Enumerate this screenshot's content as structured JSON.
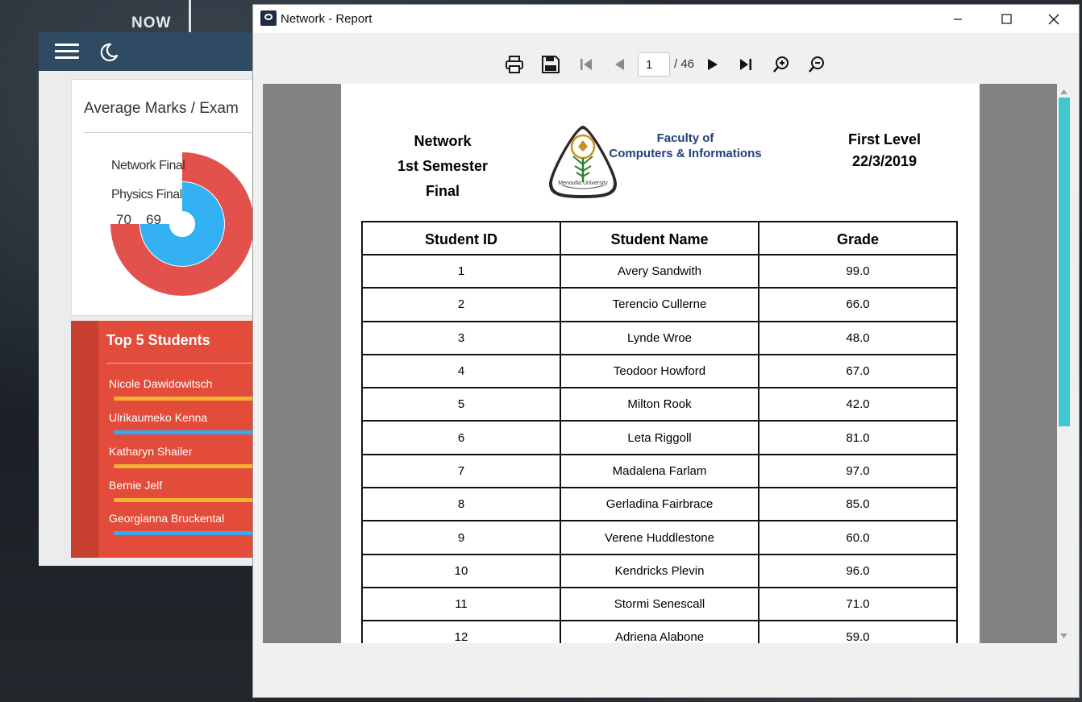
{
  "desktop": {
    "bg_text": "NOW"
  },
  "dashboard": {
    "average_card": {
      "title": "Average Marks / Exam",
      "legend": [
        "Network Final",
        "Physics Final"
      ],
      "values": [
        "70",
        "69"
      ],
      "colors": {
        "network": "#e2514c",
        "physics": "#34b1f3"
      }
    },
    "top5": {
      "title": "Top 5 Students",
      "students": [
        {
          "name": "Nicole Dawidowitsch",
          "bar_color": "#f2b233"
        },
        {
          "name": "Ulrikaumeko Kenna",
          "bar_color": "#35a9f1"
        },
        {
          "name": "Katharyn Shailer",
          "bar_color": "#f2b233"
        },
        {
          "name": "Bernie Jelf",
          "bar_color": "#f2b233"
        },
        {
          "name": "Georgianna Bruckental",
          "bar_color": "#35a9f1"
        }
      ]
    }
  },
  "report_window": {
    "title": "Network - Report",
    "toolbar": {
      "current_page": "1",
      "total_pages": "/ 46"
    },
    "report": {
      "header_left": [
        "Network",
        "1st Semester",
        "Final"
      ],
      "faculty": [
        "Faculty of",
        "Computers & Informations"
      ],
      "logo_caption": "Menoufia University",
      "header_right": [
        "First Level",
        "22/3/2019"
      ],
      "columns": [
        "Student ID",
        "Student Name",
        "Grade"
      ],
      "rows": [
        [
          "1",
          "Avery Sandwith",
          "99.0"
        ],
        [
          "2",
          "Terencio Cullerne",
          "66.0"
        ],
        [
          "3",
          "Lynde Wroe",
          "48.0"
        ],
        [
          "4",
          "Teodoor Howford",
          "67.0"
        ],
        [
          "5",
          "Milton Rook",
          "42.0"
        ],
        [
          "6",
          "Leta Riggoll",
          "81.0"
        ],
        [
          "7",
          "Madalena Farlam",
          "97.0"
        ],
        [
          "8",
          "Gerladina Fairbrace",
          "85.0"
        ],
        [
          "9",
          "Verene Huddlestone",
          "60.0"
        ],
        [
          "10",
          "Kendricks Plevin",
          "96.0"
        ],
        [
          "11",
          "Stormi Senescall",
          "71.0"
        ],
        [
          "12",
          "Adriena Alabone",
          "59.0"
        ]
      ]
    }
  }
}
